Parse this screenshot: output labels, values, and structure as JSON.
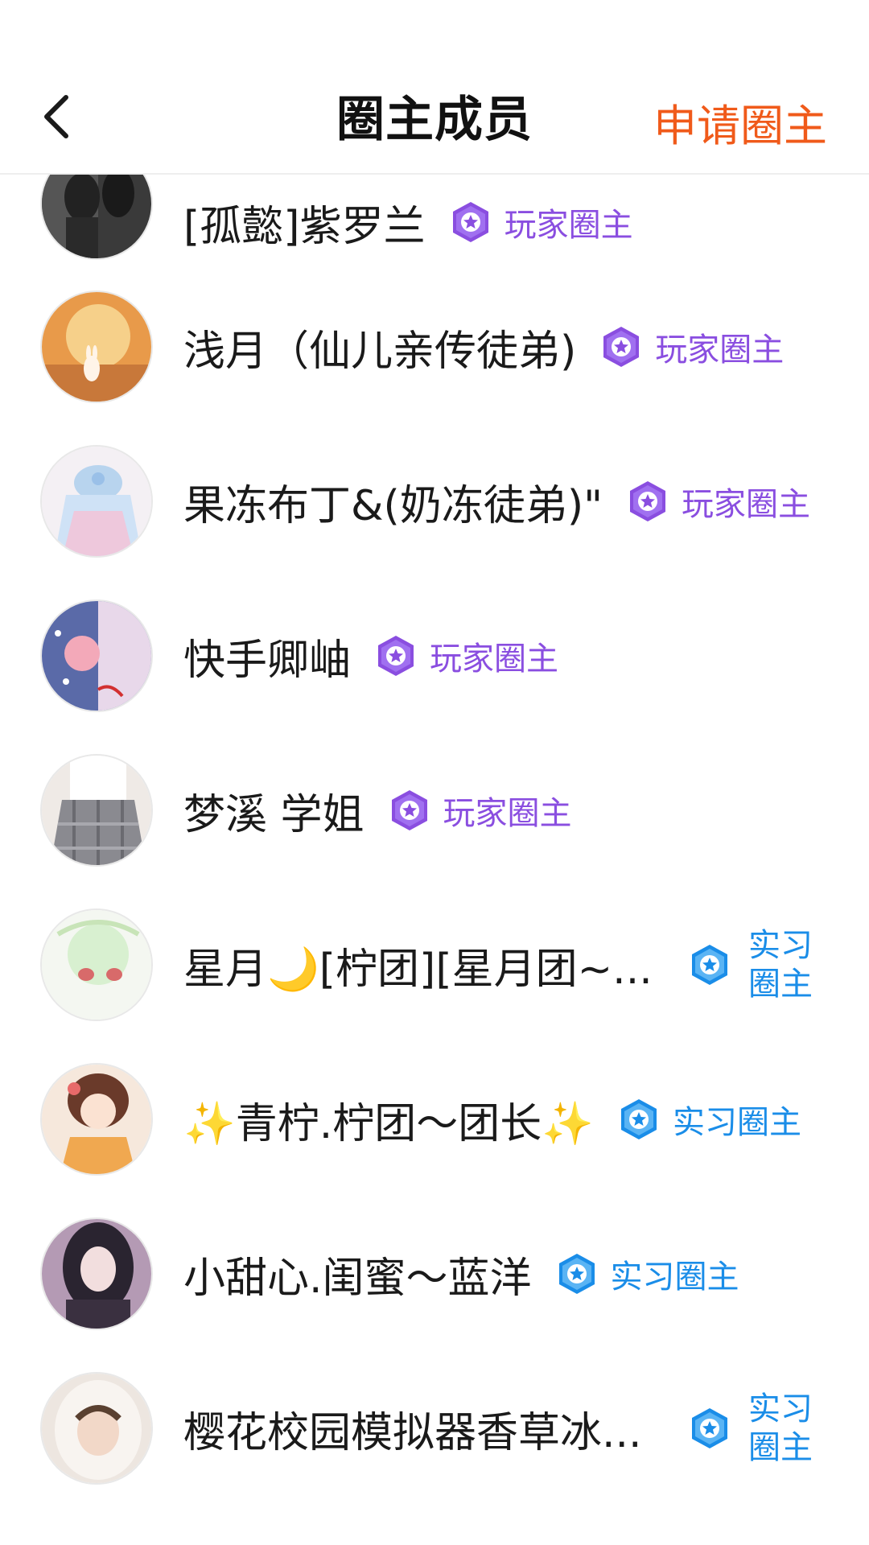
{
  "header": {
    "title": "圈主成员",
    "apply_label": "申请圈主"
  },
  "colors": {
    "accent": "#f05a1a",
    "player_badge": "#8a4ee0",
    "intern_badge": "#1a8de8"
  },
  "members": [
    {
      "name": "[孤懿]紫罗兰",
      "badge": "玩家圈主",
      "badge_icon": "purple-star-badge-icon"
    },
    {
      "name": "浅月（仙儿亲传徒弟)",
      "badge": "玩家圈主",
      "badge_icon": "purple-star-badge-icon"
    },
    {
      "name": "果冻布丁&(奶冻徒弟)\"",
      "badge": "玩家圈主",
      "badge_icon": "purple-star-badge-icon"
    },
    {
      "name": "快手卿岫",
      "badge": "玩家圈主",
      "badge_icon": "purple-star-badge-icon"
    },
    {
      "name": "梦溪 学姐",
      "badge": "玩家圈主",
      "badge_icon": "purple-star-badge-icon"
    },
    {
      "name": "星月🌙[柠团][星月团~...",
      "badge": "实习圈主",
      "badge_icon": "blue-star-badge-icon"
    },
    {
      "name": "✨青柠.柠团～团长✨",
      "badge": "实习圈主",
      "badge_icon": "blue-star-badge-icon"
    },
    {
      "name": "小甜心.闺蜜～蓝洋",
      "badge": "实习圈主",
      "badge_icon": "blue-star-badge-icon"
    },
    {
      "name": "樱花校园模拟器香草冰...",
      "badge": "实习圈主",
      "badge_icon": "blue-star-badge-icon"
    }
  ]
}
